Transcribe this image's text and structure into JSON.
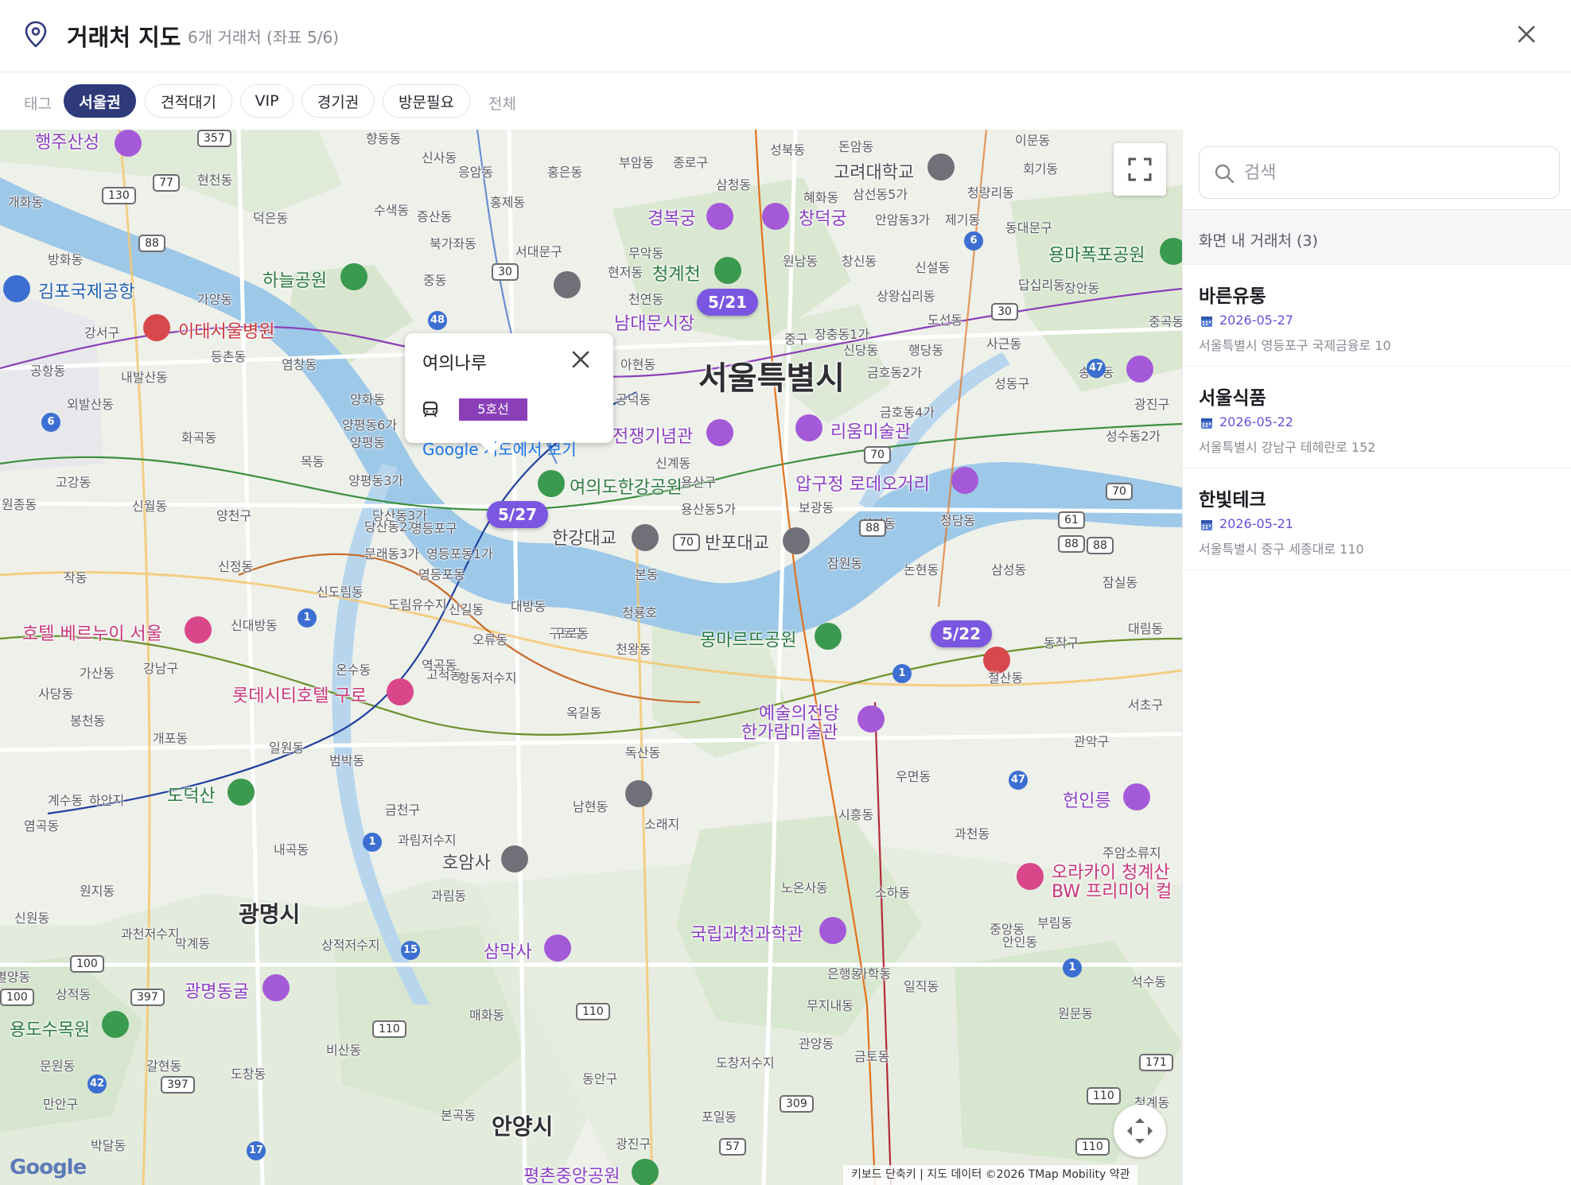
{
  "header": {
    "title": "거래처 지도",
    "subtitle": "6개 거래처 (좌표 5/6)"
  },
  "tags": {
    "label": "태그",
    "items": [
      "서울권",
      "견적대기",
      "VIP",
      "경기권",
      "방문필요"
    ],
    "active": "서울권",
    "all_label": "전체"
  },
  "map": {
    "cities": [
      "서울특별시",
      "광명시",
      "안양시"
    ],
    "pois": {
      "gimpo": "김포국제공항",
      "ewha": "이대서울병원",
      "haneul": "하늘공원",
      "haengju": "행주산성",
      "gyeongbok": "경복궁",
      "changdeok": "창덕궁",
      "cheonggye": "청계천",
      "namdaemun": "남대문시장",
      "korea_univ": "고려대학교",
      "yongmapok": "용마폭포공원",
      "warmemorial": "전쟁기념관",
      "leeum": "리움미술관",
      "apgujeong": "압구정 로데오거리",
      "yeouido_park": "여의도한강공원",
      "hangang_br": "한강대교",
      "banpo_br": "반포대교",
      "mongmarte": "몽마르뜨공원",
      "arts_center": "예술의전당",
      "hangaram": "한가람미술관",
      "hotel_vernui": "호텔 베르누이 서울",
      "lotte_city": "롯데시티호텔 구로",
      "dodeoksan": "도덕산",
      "hoamsa": "호암사",
      "heonilleung": "헌인릉",
      "okura": "오라카이 청계산",
      "bw_premier": "BW 프리미어 컬",
      "sciencemuseum": "국립과천과학관",
      "sammaksa": "삼막사",
      "gwangmyeong_cave": "광명동굴",
      "yongdo": "용도수목원",
      "pyeongchon": "평촌중앙공원"
    },
    "places": [
      "향동동",
      "신사동",
      "응암동",
      "홍은동",
      "부암동",
      "종로구",
      "성북동",
      "돈암동",
      "이문동",
      "현천동",
      "수색동",
      "증산동",
      "홍제동",
      "삼청동",
      "혜화동",
      "삼선동5가",
      "회기동",
      "개화동",
      "덕은동",
      "북가좌동",
      "서대문구",
      "무악동",
      "안암동3가",
      "제기동",
      "청량리동",
      "동대문구",
      "방화동",
      "가양동",
      "중동",
      "현저동",
      "원남동",
      "창신동",
      "신설동",
      "천연동",
      "상왕십리동",
      "답십리동",
      "장안동",
      "강서구",
      "등촌동",
      "염창동",
      "아현동",
      "중구",
      "장충동1가",
      "도선동",
      "사근동",
      "중곡동",
      "공항동",
      "내발산동",
      "신당동",
      "행당동",
      "금호동2가",
      "성동구",
      "송정동",
      "광진구",
      "외발산동",
      "양화동",
      "공덕동",
      "금호동4가",
      "화곡동",
      "양평동6가",
      "신계동",
      "성수동2가",
      "목동",
      "양평동",
      "용산구",
      "양평동3가",
      "고강동",
      "신월동",
      "양천구",
      "당산동3가",
      "당산동2가",
      "보광동",
      "용산동5가",
      "신사동",
      "청담동",
      "영등포구",
      "원종동",
      "문래동3가",
      "영등포동1가",
      "잠원동",
      "논현동",
      "삼성동",
      "잠실동",
      "신정동",
      "영등포동",
      "본동",
      "작동",
      "신도림동",
      "도림유수지",
      "대방동",
      "신길동",
      "청룡호",
      "오류동",
      "고척동",
      "구로구",
      "구로동",
      "대림동",
      "신대방동",
      "동작구",
      "강남구",
      "온수동",
      "역곡동",
      "항동저수지",
      "천왕동",
      "철산동",
      "가산동",
      "사당동",
      "봉천동",
      "개포동",
      "일원동",
      "범박동",
      "옥길동",
      "독산동",
      "관악구",
      "서초구",
      "계수동",
      "하안지",
      "금천구",
      "남현동",
      "우면동",
      "염곡동",
      "내곡동",
      "과림저수지",
      "소래지",
      "시흥동",
      "과천동",
      "주암소류지",
      "원지동",
      "신원동",
      "과림동",
      "노온사동",
      "소하동",
      "중앙동",
      "부림동",
      "과천저수지",
      "막계동",
      "상적저수지",
      "은행동",
      "안인동",
      "석수동",
      "별양동",
      "상적동",
      "매화동",
      "무지내동",
      "가학동",
      "일직동",
      "원문동",
      "문원동",
      "갈현동",
      "도창동",
      "비산동",
      "관양동",
      "금토동",
      "도창저수지",
      "만안구",
      "동안구",
      "포일동",
      "청계동",
      "박달동",
      "본곡동",
      "광진구"
    ],
    "route_shields": [
      "357",
      "77",
      "130",
      "88",
      "30",
      "48",
      "30",
      "47",
      "6",
      "6",
      "70",
      "70",
      "88",
      "70",
      "88",
      "61",
      "88",
      "1",
      "1",
      "1",
      "47",
      "15",
      "110",
      "110",
      "110",
      "100",
      "397",
      "100",
      "42",
      "397",
      "17",
      "309",
      "57",
      "110",
      "171",
      "1"
    ],
    "markers": [
      "5/21",
      "5/27",
      "5/22"
    ],
    "attribution": "키보드 단축키  |  지도 데이터 ©2026 TMap Mobility    약관",
    "google_logo": "Google"
  },
  "infowindow": {
    "title": "여의나루",
    "line": "5호선",
    "link": "Google 지도에서 보기"
  },
  "sidebar": {
    "search_placeholder": "검색",
    "section_title": "화면 내 거래처 (3)",
    "items": [
      {
        "name": "바른유통",
        "date": "2026-05-27",
        "address": "서울특별시 영등포구 국제금융로 10"
      },
      {
        "name": "서울식품",
        "date": "2026-05-22",
        "address": "서울특별시 강남구 테헤란로 152"
      },
      {
        "name": "한빛테크",
        "date": "2026-05-21",
        "address": "서울특별시 중구 세종대로 110"
      }
    ]
  },
  "colors": {
    "accent": "#2e3a7a",
    "marker": "#7b56e0",
    "river": "#9ec8e8",
    "park": "#cfe3c5"
  }
}
